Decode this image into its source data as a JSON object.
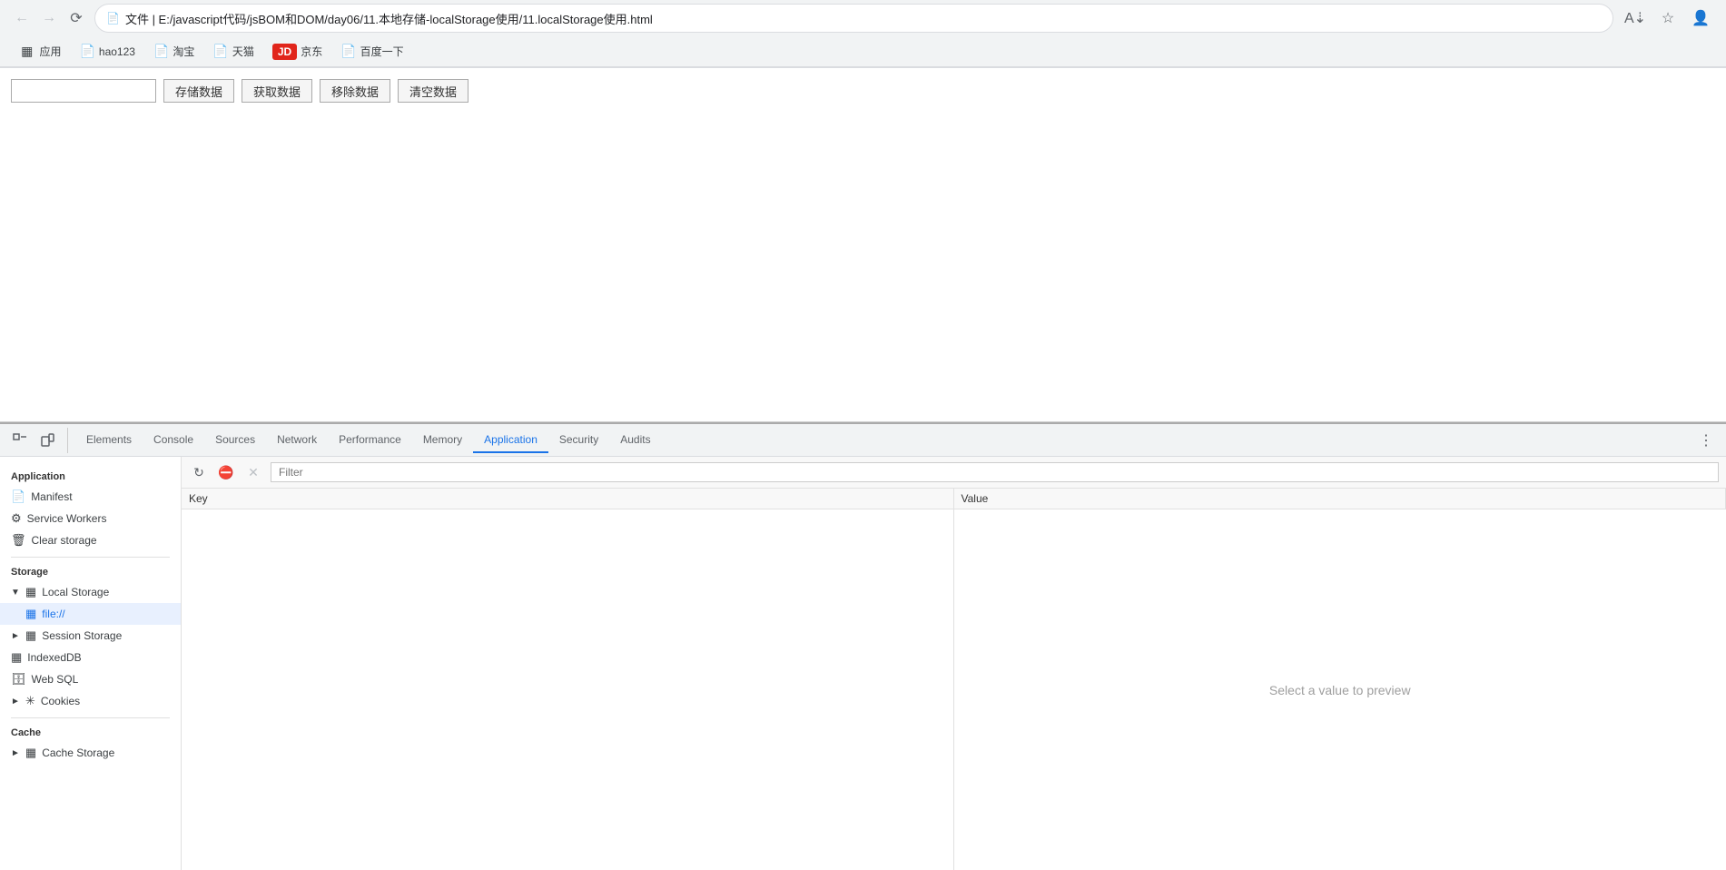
{
  "browser": {
    "title": "文件 | E:/javascript代码/jsBOM和DOM/day06/11.本地存储-localStorage使用/11.localStorage使用.html",
    "address": "文件 | E:/javascript代码/jsBOM和DOM/day06/11.本地存储-localStorage使用/11.localStorage使用.html"
  },
  "bookmarks": {
    "apps_label": "应用",
    "items": [
      {
        "label": "hao123",
        "icon": "📄"
      },
      {
        "label": "淘宝",
        "icon": "📄"
      },
      {
        "label": "天猫",
        "icon": "📄"
      },
      {
        "label": "JD 京东",
        "icon": "JD"
      },
      {
        "label": "百度一下",
        "icon": "📄"
      }
    ]
  },
  "page": {
    "input_placeholder": "",
    "btn_store": "存储数据",
    "btn_get": "获取数据",
    "btn_remove": "移除数据",
    "btn_clear": "清空数据"
  },
  "devtools": {
    "tabs": [
      {
        "label": "Elements",
        "active": false
      },
      {
        "label": "Console",
        "active": false
      },
      {
        "label": "Sources",
        "active": false
      },
      {
        "label": "Network",
        "active": false
      },
      {
        "label": "Performance",
        "active": false
      },
      {
        "label": "Memory",
        "active": false
      },
      {
        "label": "Application",
        "active": true
      },
      {
        "label": "Security",
        "active": false
      },
      {
        "label": "Audits",
        "active": false
      }
    ],
    "filter_placeholder": "Filter",
    "sidebar": {
      "section_application": "Application",
      "section_storage": "Storage",
      "section_cache": "Cache",
      "items": [
        {
          "label": "Manifest",
          "icon": "📄",
          "type": "manifest"
        },
        {
          "label": "Service Workers",
          "icon": "⚙",
          "type": "service-workers"
        },
        {
          "label": "Clear storage",
          "icon": "🗑",
          "type": "clear-storage"
        },
        {
          "label": "Local Storage",
          "icon": "▦",
          "type": "local-storage",
          "expanded": true
        },
        {
          "label": "file://",
          "icon": "▦",
          "type": "file-local",
          "active": true
        },
        {
          "label": "Session Storage",
          "icon": "▦",
          "type": "session-storage",
          "expanded": false
        },
        {
          "label": "IndexedDB",
          "icon": "▦",
          "type": "indexeddb"
        },
        {
          "label": "Web SQL",
          "icon": "🗄",
          "type": "websql"
        },
        {
          "label": "Cookies",
          "icon": "🍪",
          "type": "cookies"
        },
        {
          "label": "Cache Storage",
          "icon": "▦",
          "type": "cache-storage"
        }
      ]
    },
    "table": {
      "col_key": "Key",
      "col_value": "Value",
      "preview_text": "Select a value to preview"
    }
  }
}
